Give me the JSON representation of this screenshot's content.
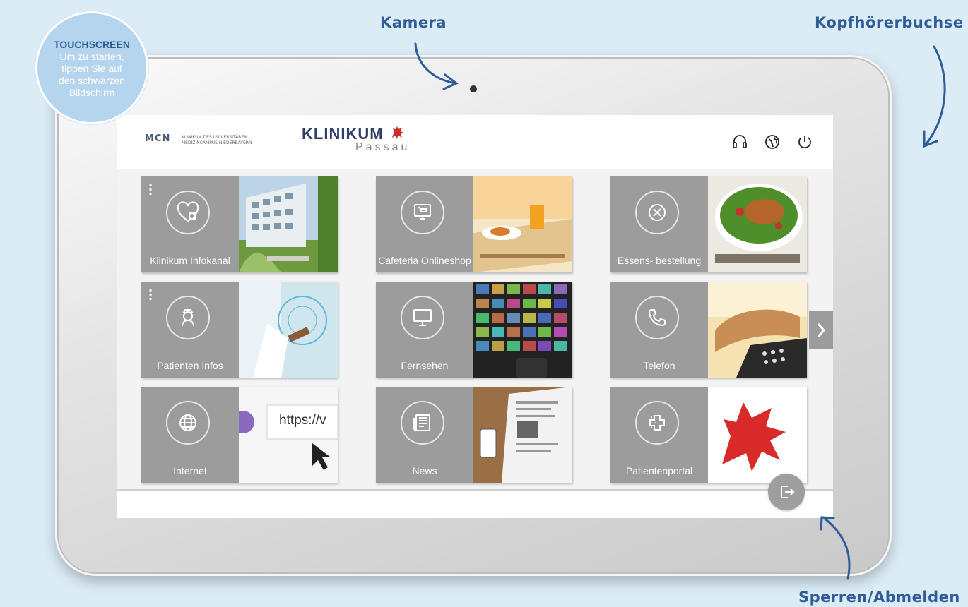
{
  "callouts": {
    "camera": "Kamera",
    "headphone": "Kopfhörerbuchse",
    "lock": "Sperren/Abmelden"
  },
  "bubble": {
    "title": "TOUCHSCREEN",
    "text": "Um zu starten, tippen Sie auf den schwarzen Bildschirm"
  },
  "header": {
    "mcn_mark": "MCN",
    "mcn_text": "KLINIKUM DES UNIVERSITÄREN MEDIZINCAMPUS NIEDERBAYERN",
    "logo_word": "KLINIKUM",
    "logo_sub": "Passau",
    "icons": [
      "headphones-icon",
      "globe-icon",
      "power-icon"
    ]
  },
  "tiles": [
    {
      "label": "Klinikum Infokanal",
      "icon": "heart-plus-icon",
      "menu": true
    },
    {
      "label": "Cafeteria Onlineshop",
      "icon": "cart-screen-icon",
      "menu": false
    },
    {
      "label": "Essens- bestellung",
      "icon": "fork-knife-icon",
      "menu": false
    },
    {
      "label": "Patienten Infos",
      "icon": "nurse-icon",
      "menu": true
    },
    {
      "label": "Fernsehen",
      "icon": "monitor-icon",
      "menu": false
    },
    {
      "label": "Telefon",
      "icon": "phone-icon",
      "menu": false
    },
    {
      "label": "Internet",
      "icon": "globe-icon",
      "menu": false
    },
    {
      "label": "News",
      "icon": "newspaper-icon",
      "menu": false
    },
    {
      "label": "Patientenportal",
      "icon": "medical-cross-icon",
      "menu": false
    }
  ],
  "internet_tile_text": "https://v",
  "colors": {
    "accent": "#2e5d97",
    "tile_gray": "#9c9c9c",
    "brand_red": "#c9302c",
    "brand_navy": "#2f3f6a"
  }
}
